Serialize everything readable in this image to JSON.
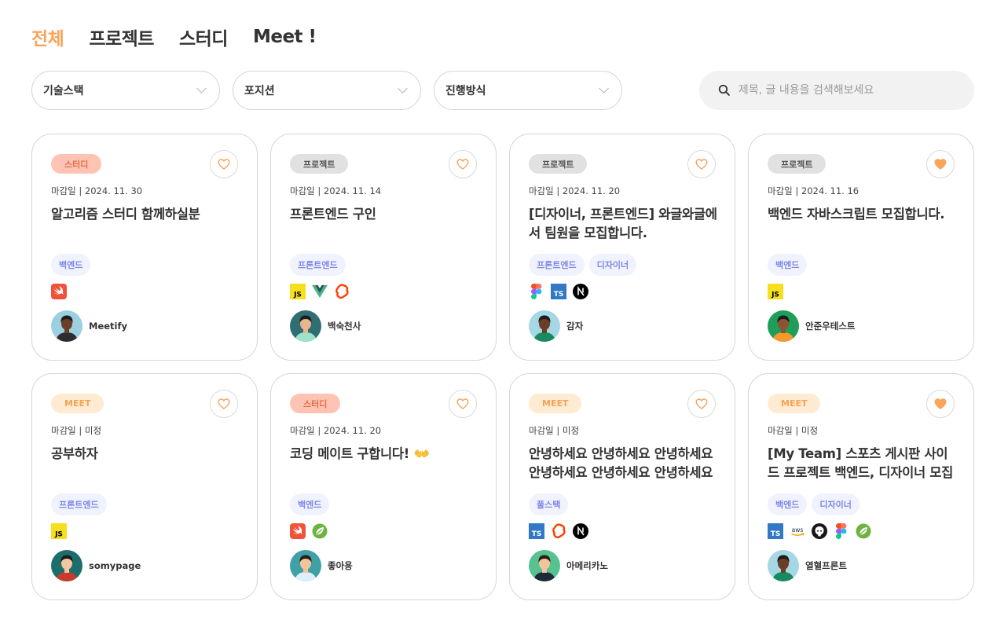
{
  "tabs": [
    "전체",
    "프로젝트",
    "스터디",
    "Meet !"
  ],
  "filters": {
    "stack": "기술스택",
    "position": "포지션",
    "mode": "진행방식"
  },
  "search": {
    "placeholder": "제목, 글 내용을 검색해보세요"
  },
  "colors": {
    "accent": "#F8A45B",
    "study_bg": "#FFC3B3",
    "project_bg": "#E1E1E1",
    "meet_bg": "#FFEBD2",
    "position_text": "#7E86E6"
  },
  "cards": [
    {
      "type": "스터디",
      "kind": "study",
      "deadline": "마감일 | 2024. 11. 30",
      "title": "알고리즘 스터디 함께하실분",
      "positions": [
        "백엔드"
      ],
      "stacks": [
        "swift"
      ],
      "author": "Meetify",
      "liked": false,
      "avatar": "avatar-dark-skin"
    },
    {
      "type": "프로젝트",
      "kind": "project",
      "deadline": "마감일 | 2024. 11. 14",
      "title": "프론트엔드 구인",
      "positions": [
        "프론트엔드"
      ],
      "stacks": [
        "javascript",
        "vue",
        "svelte"
      ],
      "author": "백숙천사",
      "liked": false,
      "avatar": "avatar-teal"
    },
    {
      "type": "프로젝트",
      "kind": "project",
      "deadline": "마감일 | 2024. 11. 20",
      "title": "[디자이너, 프론트엔드] 와글와글에서 팀원을 모집합니다.",
      "positions": [
        "프론트엔드",
        "디자이너"
      ],
      "stacks": [
        "figma",
        "typescript",
        "nextjs"
      ],
      "author": "감자",
      "liked": false,
      "avatar": "avatar-curly-dark"
    },
    {
      "type": "프로젝트",
      "kind": "project",
      "deadline": "마감일 | 2024. 11. 16",
      "title": "백엔드 자바스크립트 모집합니다.",
      "positions": [
        "백엔드"
      ],
      "stacks": [
        "javascript"
      ],
      "author": "안준우테스트",
      "liked": true,
      "avatar": "avatar-long-hair"
    },
    {
      "type": "MEET",
      "kind": "meet",
      "deadline": "마감일 | 미정",
      "title": "공부하자",
      "positions": [
        "프론트엔드"
      ],
      "stacks": [
        "javascript"
      ],
      "author": "somypage",
      "liked": false,
      "avatar": "avatar-glasses"
    },
    {
      "type": "스터디",
      "kind": "study",
      "deadline": "마감일 | 2024. 11. 20",
      "title": "코딩 메이트 구합니다! 👐",
      "positions": [
        "백엔드"
      ],
      "stacks": [
        "swift",
        "spring"
      ],
      "author": "좋아용",
      "liked": false,
      "avatar": "avatar-teal-boy"
    },
    {
      "type": "MEET",
      "kind": "meet",
      "deadline": "마감일 | 미정",
      "title": "안녕하세요 안녕하세요 안녕하세요 안녕하세요 안녕하세요 안녕하세요",
      "positions": [
        "풀스택"
      ],
      "stacks": [
        "typescript",
        "svelte",
        "nextjs"
      ],
      "author": "아메리카노",
      "liked": false,
      "avatar": "avatar-suit"
    },
    {
      "type": "MEET",
      "kind": "meet",
      "deadline": "마감일 | 미정",
      "title": "[My Team] 스포츠 게시판 사이드 프로젝트 백엔드, 디자이너 모집",
      "positions": [
        "백엔드",
        "디자이너"
      ],
      "stacks": [
        "typescript",
        "aws",
        "github",
        "figma",
        "spring"
      ],
      "author": "열혈프론트",
      "liked": true,
      "avatar": "avatar-curly-dark"
    }
  ]
}
